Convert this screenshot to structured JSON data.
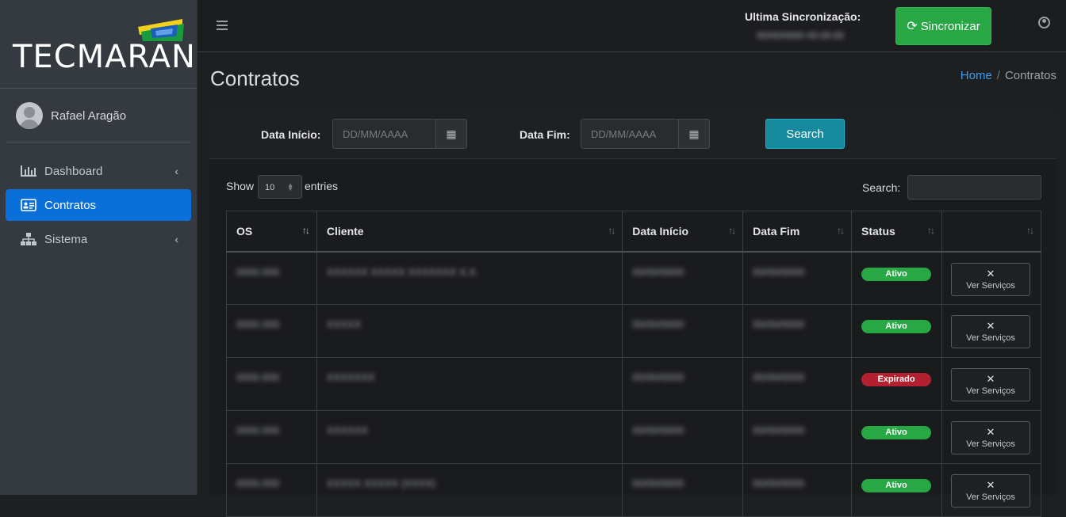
{
  "brand": {
    "name": "TECMARAN"
  },
  "user": {
    "name": "Rafael Aragão"
  },
  "nav": [
    {
      "label": "Dashboard",
      "icon": "bar-chart-icon",
      "active": false,
      "caret": "‹"
    },
    {
      "label": "Contratos",
      "icon": "id-card-icon",
      "active": true,
      "caret": ""
    },
    {
      "label": "Sistema",
      "icon": "sitemap-icon",
      "active": false,
      "caret": "‹"
    }
  ],
  "topbar": {
    "sync_label": "Ultima Sincronização:",
    "sync_time": "00/00/0000 00:00:00",
    "sync_button": "Sincronizar"
  },
  "page": {
    "title": "Contratos"
  },
  "breadcrumb": {
    "home": "Home",
    "separator": "/",
    "current": "Contratos"
  },
  "filters": {
    "start_label": "Data Início:",
    "start_placeholder": "DD/MM/AAAA",
    "end_label": "Data Fim:",
    "end_placeholder": "DD/MM/AAAA",
    "search_button": "Search"
  },
  "table_controls": {
    "show_label": "Show",
    "entries_value": "10",
    "entries_label": "entries",
    "search_label": "Search:"
  },
  "table": {
    "columns": [
      "OS",
      "Cliente",
      "Data Início",
      "Data Fim",
      "Status",
      ""
    ],
    "action_label": "Ver Serviços",
    "rows": [
      {
        "os": "0000.000",
        "cliente": "XXXXXX XXXXX XXXXXXX X.X.",
        "inicio": "00/00/0000",
        "fim": "00/00/0000",
        "status": "Ativo"
      },
      {
        "os": "0000.000",
        "cliente": "XXXXX",
        "inicio": "00/00/0000",
        "fim": "00/00/0000",
        "status": "Ativo"
      },
      {
        "os": "0000.000",
        "cliente": "XXXXXXX",
        "inicio": "00/00/0000",
        "fim": "00/00/0000",
        "status": "Expirado"
      },
      {
        "os": "0000.000",
        "cliente": "XXXXXX",
        "inicio": "00/00/0000",
        "fim": "00/00/0000",
        "status": "Ativo"
      },
      {
        "os": "0000.000",
        "cliente": "XXXXX XXXXX (XXXX)",
        "inicio": "00/00/0000",
        "fim": "00/00/0000",
        "status": "Ativo"
      }
    ]
  },
  "colors": {
    "sidebar_bg": "#343a40",
    "active_nav": "#0a6fd8",
    "sync_green": "#28a745",
    "search_teal": "#168a9c",
    "badge_active": "#28a745",
    "badge_expired": "#b3202f"
  }
}
